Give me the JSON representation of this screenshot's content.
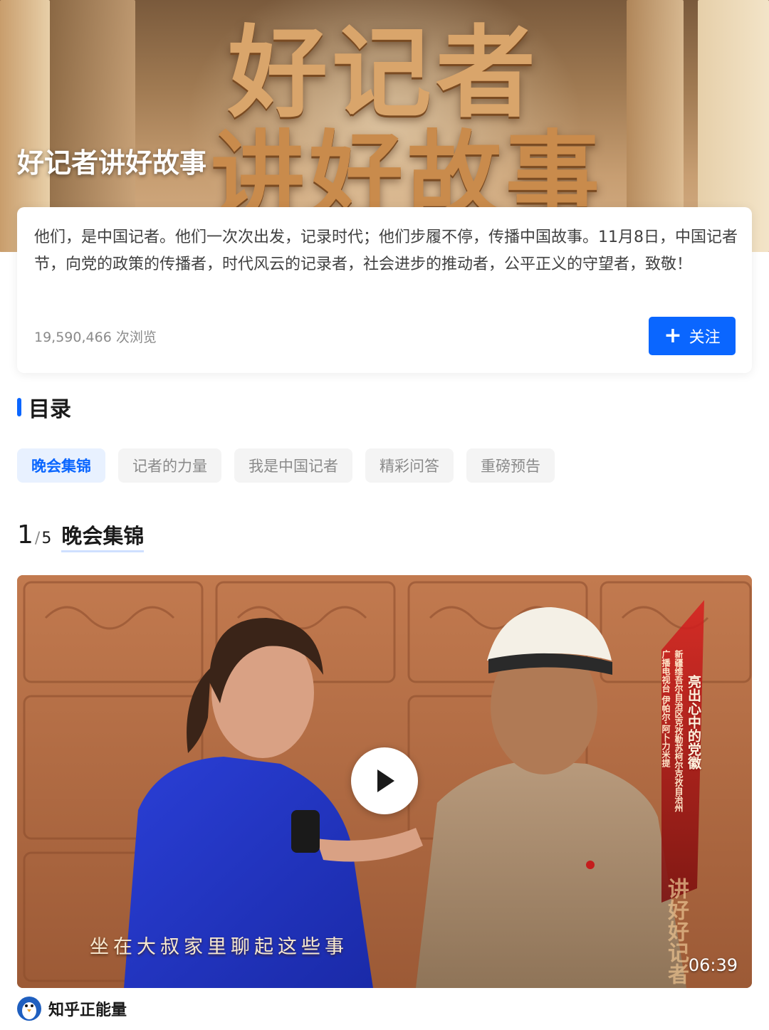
{
  "banner": {
    "big_line1": "好记者",
    "big_line2": "讲好故事",
    "caption": "好记者讲好故事"
  },
  "card": {
    "description": "他们，是中国记者。他们一次次出发，记录时代；他们步履不停，传播中国故事。11月8日，中国记者节，向党的政策的传播者，时代风云的记录者，社会进步的推动者，公平正义的守望者，致敬！",
    "views": "19,590,466 次浏览",
    "follow_label": "关注",
    "follow_icon": "plus-icon"
  },
  "section": {
    "title": "目录"
  },
  "tabs": [
    {
      "label": "晚会集锦",
      "active": true
    },
    {
      "label": "记者的力量",
      "active": false
    },
    {
      "label": "我是中国记者",
      "active": false
    },
    {
      "label": "精彩问答",
      "active": false
    },
    {
      "label": "重磅预告",
      "active": false
    }
  ],
  "item": {
    "index": "1",
    "total": "5",
    "title": "晚会集锦"
  },
  "video": {
    "subtitle": "坐在大叔家里聊起这些事",
    "duration": "06:39",
    "overlay_title": "亮出心中的党徽",
    "overlay_reporter_line1": "新疆维吾尔自治区克孜勒苏柯尔克孜自治州",
    "overlay_reporter_line2": "广播电视台 伊帕尔·阿卜力米提",
    "watermark": "讲好好记者",
    "play_icon": "play-icon"
  },
  "author": {
    "name": "知乎正能量",
    "avatar_icon": "penguin-avatar-icon"
  },
  "colors": {
    "accent": "#0a66ff",
    "tab_active_bg": "#e8f1ff",
    "tab_bg": "#f4f4f4"
  }
}
